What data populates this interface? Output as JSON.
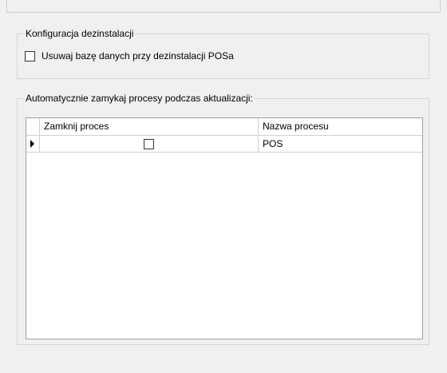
{
  "uninstall_config": {
    "legend": "Konfiguracja dezinstalacji",
    "delete_db_label": "Usuwaj bazę danych przy dezinstalacji POSa",
    "delete_db_checked": false
  },
  "auto_close": {
    "legend": "Automatycznie zamykaj procesy podczas aktualizacji:",
    "columns": [
      "Zamknij proces",
      "Nazwa procesu"
    ],
    "rows": [
      {
        "close": false,
        "name": "POS",
        "current": true
      }
    ]
  }
}
